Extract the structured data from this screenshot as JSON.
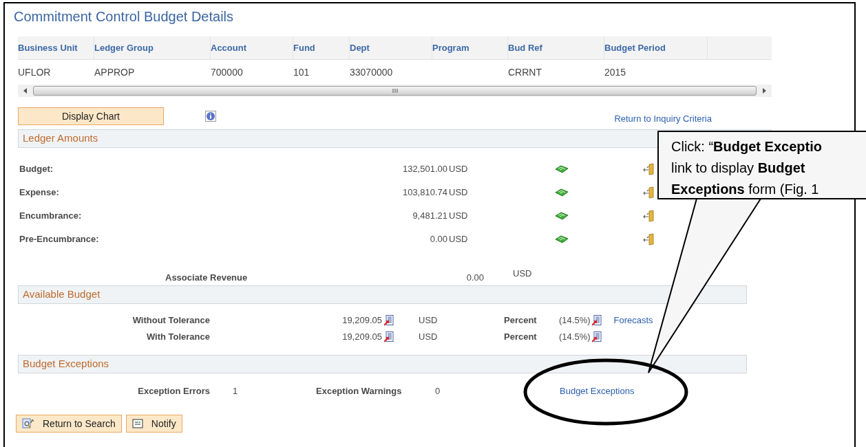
{
  "title": "Commitment Control Budget Details",
  "table": {
    "columns": [
      "Business Unit",
      "Ledger Group",
      "Account",
      "Fund",
      "Dept",
      "Program",
      "Bud Ref",
      "Budget Period"
    ],
    "rows": [
      {
        "cells": [
          "UFLOR",
          "APPROP",
          "700000",
          "101",
          "33070000",
          null,
          "CRRNT",
          "2015"
        ]
      }
    ]
  },
  "display_chart": "Display Chart",
  "return_link": "Return to Inquiry Criteria",
  "ledger": {
    "title": "Ledger Amounts",
    "rows": [
      {
        "label": "Budget:",
        "amount": "132,501.00",
        "currency": "USD"
      },
      {
        "label": "Expense:",
        "amount": "103,810.74",
        "currency": "USD"
      },
      {
        "label": "Encumbrance:",
        "amount": "9,481.21",
        "currency": "USD"
      },
      {
        "label": "Pre-Encumbrance:",
        "amount": "0.00",
        "currency": "USD"
      }
    ],
    "associate": {
      "label": "Associate Revenue",
      "amount": "0.00",
      "currency": "USD"
    }
  },
  "available": {
    "title": "Available Budget",
    "rows": [
      {
        "label": "Without Tolerance",
        "amount": "19,209.05",
        "currency": "USD",
        "percent_label": "Percent",
        "percent": "(14.5%)"
      },
      {
        "label": "With Tolerance",
        "amount": "19,209.05",
        "currency": "USD",
        "percent_label": "Percent",
        "percent": "(14.5%)"
      }
    ],
    "link": "Forecasts"
  },
  "exceptions": {
    "title": "Budget Exceptions",
    "errors_label": "Exception Errors",
    "errors": "1",
    "warnings_label": "Exception Warnings",
    "warnings": "0",
    "link": "Budget Exceptions"
  },
  "footer_buttons": [
    {
      "kind": "search",
      "label": "Return to Search"
    },
    {
      "kind": "notify",
      "label": "Notify"
    }
  ],
  "callout": {
    "text": "Click: “**Budget Exceptio**\nlink to display **Budget**\n**Exceptions** form (Fig. 1"
  }
}
